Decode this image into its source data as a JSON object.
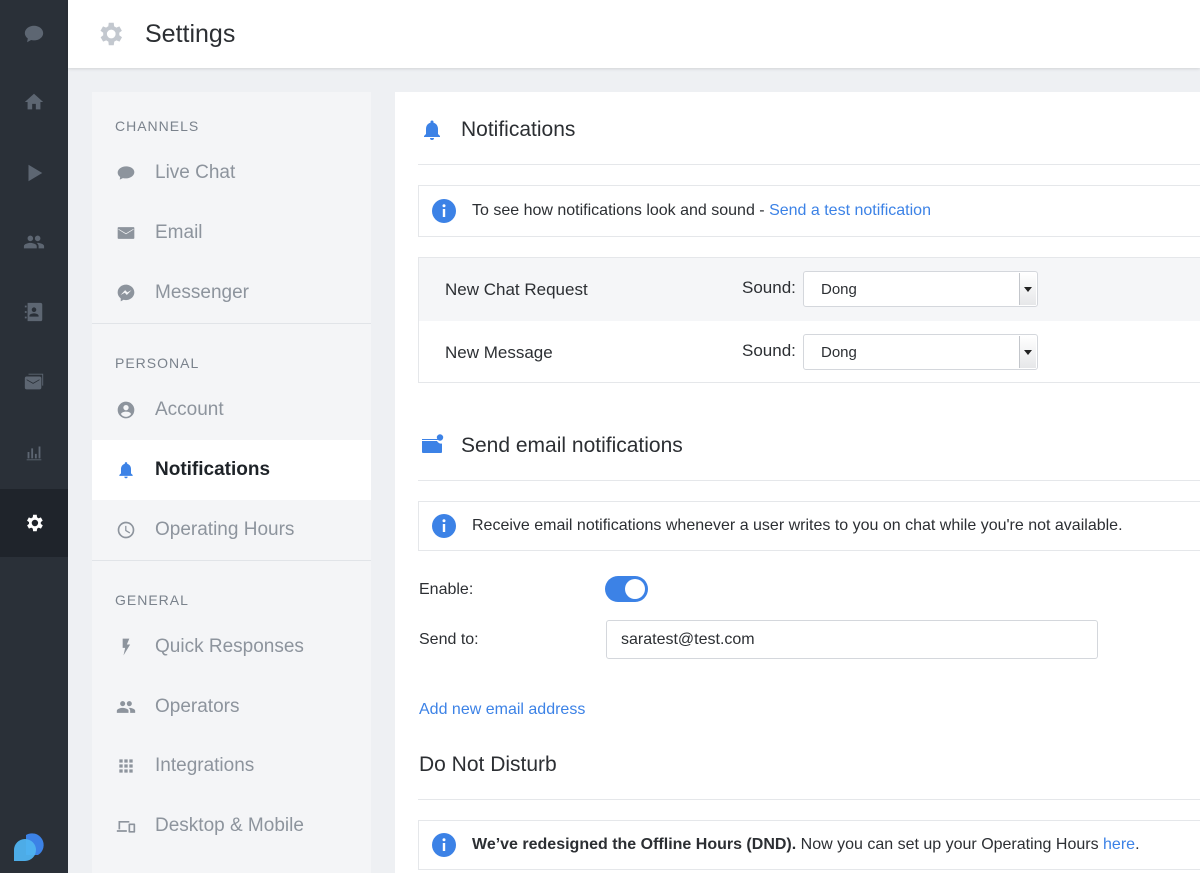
{
  "header": {
    "title": "Settings"
  },
  "rail": {
    "items": [
      "chat-icon",
      "home-icon",
      "play-icon",
      "people-icon",
      "contacts-icon",
      "inbox-icon",
      "analytics-icon",
      "settings-icon"
    ],
    "active": "settings-icon"
  },
  "nav": {
    "sections": {
      "channels": "CHANNELS",
      "personal": "PERSONAL",
      "general": "GENERAL"
    },
    "items": {
      "live_chat": "Live Chat",
      "email": "Email",
      "messenger": "Messenger",
      "account": "Account",
      "notifications": "Notifications",
      "operating_hours": "Operating Hours",
      "quick_responses": "Quick Responses",
      "operators": "Operators",
      "integrations": "Integrations",
      "desktop_mobile": "Desktop & Mobile"
    },
    "active": "notifications"
  },
  "main": {
    "notifications": {
      "title": "Notifications",
      "info_text": "To see how notifications look and sound -",
      "info_link": "Send a test notification",
      "rows": [
        {
          "name": "New Chat Request",
          "sound_label": "Sound:",
          "value": "Dong"
        },
        {
          "name": "New Message",
          "sound_label": "Sound:",
          "value": "Dong"
        }
      ]
    },
    "email": {
      "title": "Send email notifications",
      "info_text": "Receive email notifications whenever a user writes to you on chat while you're not available.",
      "enable_label": "Enable:",
      "enabled": true,
      "send_to_label": "Send to:",
      "send_to_value": "saratest@test.com",
      "add_link": "Add new email address"
    },
    "dnd": {
      "title": "Do Not Disturb",
      "info_bold": "We’ve redesigned the Offline Hours (DND).",
      "info_text": " Now you can set up your Operating Hours ",
      "info_link": "here",
      "info_end": "."
    }
  },
  "colors": {
    "accent": "#3c82e6",
    "rail_bg": "#2a3038",
    "nav_bg": "#f4f5f7"
  }
}
